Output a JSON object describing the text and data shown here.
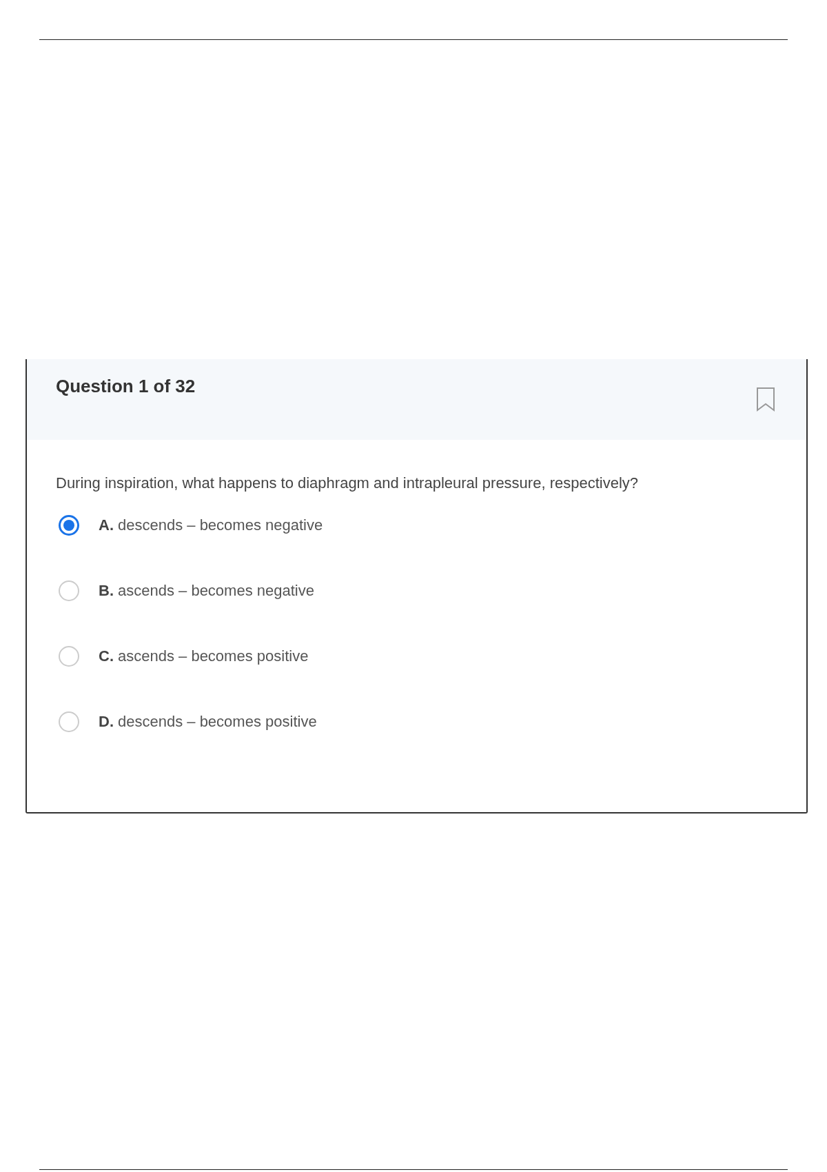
{
  "question": {
    "title": "Question 1 of 32",
    "bookmarked": false,
    "prompt": "During inspiration, what happens to diaphragm and intrapleural pressure, respectively?",
    "options": [
      {
        "letter": "A.",
        "text": "descends – becomes negative",
        "selected": true
      },
      {
        "letter": "B.",
        "text": "ascends – becomes negative",
        "selected": false
      },
      {
        "letter": "C.",
        "text": "ascends – becomes positive",
        "selected": false
      },
      {
        "letter": "D.",
        "text": "descends – becomes positive",
        "selected": false
      }
    ]
  }
}
